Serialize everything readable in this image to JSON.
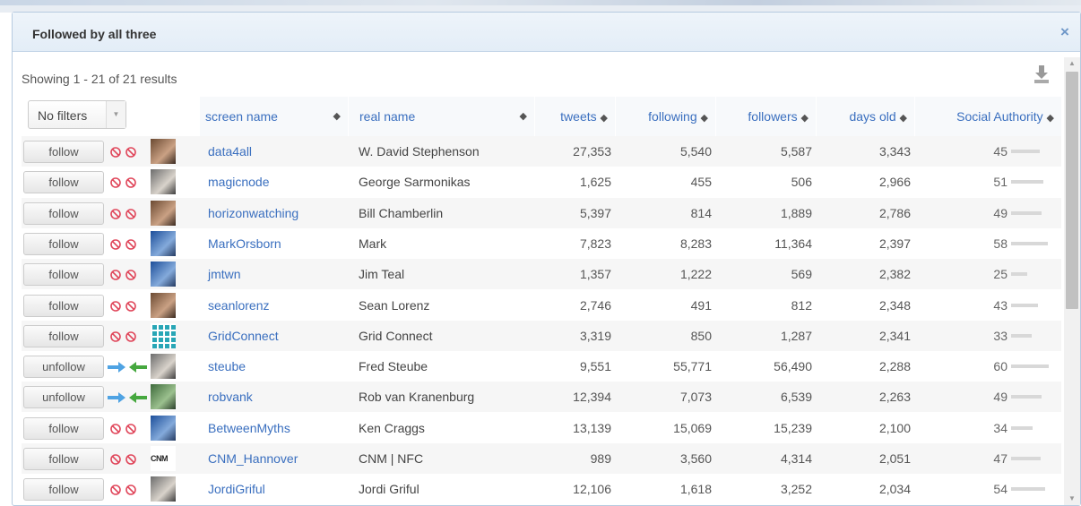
{
  "dialog": {
    "title": "Followed by all three",
    "close_label": "×"
  },
  "results": {
    "text": "Showing 1 - 21 of 21 results"
  },
  "filter": {
    "selected": "No filters",
    "arrow": "▼"
  },
  "columns": {
    "screen_name": "screen name",
    "real_name": "real name",
    "tweets": "tweets",
    "following": "following",
    "followers": "followers",
    "days_old": "days old",
    "social_authority": "Social Authority",
    "sort_glyph": "◆"
  },
  "colors": {
    "link": "#3a6fbf",
    "no_relation": "#e0475b",
    "follows_arrow_in": "#4fa3e3",
    "follows_arrow_out": "#46a83f"
  },
  "rows": [
    {
      "action": "follow",
      "relation": "none",
      "avatar": "photo",
      "screen_name": "data4all",
      "real_name": "W. David Stephenson",
      "tweets": "27,353",
      "following": "5,540",
      "followers": "5,587",
      "days_old": "3,343",
      "authority": 45
    },
    {
      "action": "follow",
      "relation": "none",
      "avatar": "gray",
      "screen_name": "magicnode",
      "real_name": "George Sarmonikas",
      "tweets": "1,625",
      "following": "455",
      "followers": "506",
      "days_old": "2,966",
      "authority": 51
    },
    {
      "action": "follow",
      "relation": "none",
      "avatar": "photo",
      "screen_name": "horizonwatching",
      "real_name": "Bill Chamberlin",
      "tweets": "5,397",
      "following": "814",
      "followers": "1,889",
      "days_old": "2,786",
      "authority": 49
    },
    {
      "action": "follow",
      "relation": "none",
      "avatar": "blue",
      "screen_name": "MarkOrsborn",
      "real_name": "Mark",
      "tweets": "7,823",
      "following": "8,283",
      "followers": "11,364",
      "days_old": "2,397",
      "authority": 58
    },
    {
      "action": "follow",
      "relation": "none",
      "avatar": "blue",
      "screen_name": "jmtwn",
      "real_name": "Jim Teal",
      "tweets": "1,357",
      "following": "1,222",
      "followers": "569",
      "days_old": "2,382",
      "authority": 25
    },
    {
      "action": "follow",
      "relation": "none",
      "avatar": "photo",
      "screen_name": "seanlorenz",
      "real_name": "Sean Lorenz",
      "tweets": "2,746",
      "following": "491",
      "followers": "812",
      "days_old": "2,348",
      "authority": 43
    },
    {
      "action": "follow",
      "relation": "none",
      "avatar": "grid",
      "screen_name": "GridConnect",
      "real_name": "Grid Connect",
      "tweets": "3,319",
      "following": "850",
      "followers": "1,287",
      "days_old": "2,341",
      "authority": 33
    },
    {
      "action": "unfollow",
      "relation": "mutual",
      "avatar": "gray",
      "screen_name": "steube",
      "real_name": "Fred Steube",
      "tweets": "9,551",
      "following": "55,771",
      "followers": "56,490",
      "days_old": "2,288",
      "authority": 60
    },
    {
      "action": "unfollow",
      "relation": "mutual",
      "avatar": "green",
      "screen_name": "robvank",
      "real_name": "Rob van Kranenburg",
      "tweets": "12,394",
      "following": "7,073",
      "followers": "6,539",
      "days_old": "2,263",
      "authority": 49
    },
    {
      "action": "follow",
      "relation": "none",
      "avatar": "blue",
      "screen_name": "BetweenMyths",
      "real_name": "Ken Craggs",
      "tweets": "13,139",
      "following": "15,069",
      "followers": "15,239",
      "days_old": "2,100",
      "authority": 34
    },
    {
      "action": "follow",
      "relation": "none",
      "avatar": "cnm",
      "avatar_text": "CNM",
      "screen_name": "CNM_Hannover",
      "real_name": "CNM | NFC",
      "tweets": "989",
      "following": "3,560",
      "followers": "4,314",
      "days_old": "2,051",
      "authority": 47
    },
    {
      "action": "follow",
      "relation": "none",
      "avatar": "gray",
      "screen_name": "JordiGriful",
      "real_name": "Jordi Griful",
      "tweets": "12,106",
      "following": "1,618",
      "followers": "3,252",
      "days_old": "2,034",
      "authority": 54
    }
  ]
}
